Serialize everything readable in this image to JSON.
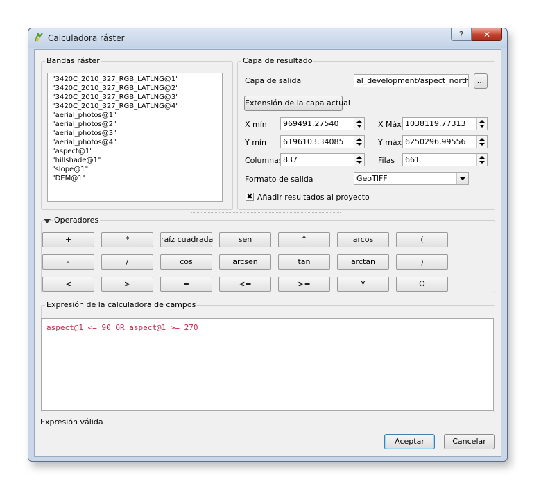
{
  "window": {
    "title": "Calculadora ráster",
    "help_label": "?",
    "close_label": "✕"
  },
  "bands": {
    "title": "Bandas ráster",
    "items": [
      "\"3420C_2010_327_RGB_LATLNG@1\"",
      "\"3420C_2010_327_RGB_LATLNG@2\"",
      "\"3420C_2010_327_RGB_LATLNG@3\"",
      "\"3420C_2010_327_RGB_LATLNG@4\"",
      "\"aerial_photos@1\"",
      "\"aerial_photos@2\"",
      "\"aerial_photos@3\"",
      "\"aerial_photos@4\"",
      "\"aspect@1\"",
      "\"hillshade@1\"",
      "\"slope@1\"",
      "\"DEM@1\""
    ]
  },
  "result": {
    "title": "Capa de resultado",
    "output_label": "Capa de salida",
    "output_value": "al_development/aspect_north.tif",
    "browse_label": "...",
    "extent_button": "Extensión de la capa actual",
    "xmin_label": "X mín",
    "xmin_value": "969491,27540",
    "xmax_label": "X Máx",
    "xmax_value": "1038119,77313",
    "ymin_label": "Y mín",
    "ymin_value": "6196103,34085",
    "ymax_label": "Y máx",
    "ymax_value": "6250296,99556",
    "cols_label": "Columnas",
    "cols_value": "837",
    "rows_label": "Filas",
    "rows_value": "661",
    "format_label": "Formato de salida",
    "format_value": "GeoTIFF",
    "add_label": "Añadir resultados al proyecto",
    "add_checked": "✖"
  },
  "operators": {
    "title": "Operadores",
    "row1": [
      "+",
      "*",
      "raíz cuadrada",
      "sen",
      "^",
      "arcos",
      "("
    ],
    "row2": [
      "-",
      "/",
      "cos",
      "arcsen",
      "tan",
      "arctan",
      ")"
    ],
    "row3": [
      "<",
      ">",
      "=",
      "<=",
      ">=",
      "Y",
      "O"
    ]
  },
  "expression": {
    "title": "Expresión de la calculadora de campos",
    "text": "aspect@1 <= 90 OR aspect@1 >= 270"
  },
  "status": "Expresión válida",
  "buttons": {
    "ok": "Aceptar",
    "cancel": "Cancelar"
  }
}
